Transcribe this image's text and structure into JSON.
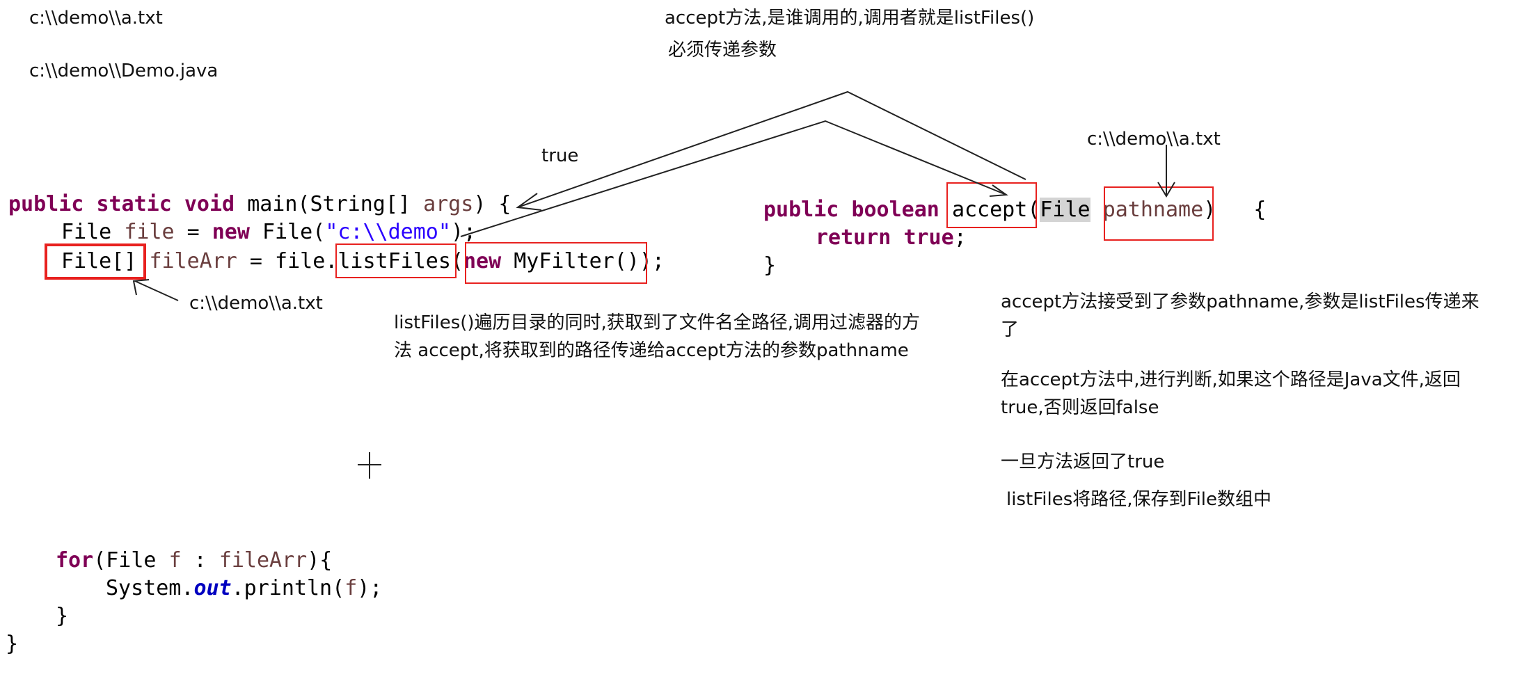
{
  "paths": {
    "a_txt": "c:\\\\demo\\\\a.txt",
    "demo_java": "c:\\\\demo\\\\Demo.java",
    "a_txt_below_file": "c:\\\\demo\\\\a.txt",
    "a_txt_pathname": "c:\\\\demo\\\\a.txt"
  },
  "notes": {
    "true_label": "true",
    "accept_caller_line1": "accept方法,是谁调用的,调用者就是listFiles()",
    "accept_caller_line2": "必须传递参数",
    "listfiles_explain": "listFiles()遍历目录的同时,获取到了文件名全路径,调用过滤器的方法 accept,将获取到的路径传递给accept方法的参数pathname",
    "accept_receive": "accept方法接受到了参数pathname,参数是listFiles传递来了",
    "accept_judge": "在accept方法中,进行判断,如果这个路径是Java文件,返回true,否则返回false",
    "once_true": "一旦方法返回了true",
    "save_array": "listFiles将路径,保存到File数组中"
  },
  "code_main": {
    "kw_public": "public",
    "kw_static": "static",
    "kw_void": "void",
    "main_sig": "main(String[] ",
    "args": "args",
    "open_brace": ") {",
    "file_type": "File ",
    "file_var": "file",
    "assign": " = ",
    "kw_new": "new",
    "new_file_call": " File(",
    "demo_string": "\"c:\\\\demo\"",
    "close_call": ");",
    "array_type": "File[]",
    "file_arr_var": "fileArr",
    "file_dot": " = file.",
    "list_files": "listFiles",
    "open_paren": "(",
    "my_filter": " MyFilter()",
    "end_call": ");",
    "kw_for": "for",
    "for_open": "(File ",
    "f_var": "f",
    "colon": " : ",
    "for_arr": "fileArr",
    "for_close": "){",
    "system": "System.",
    "out": "out",
    "println": ".println(",
    "f_arg": "f",
    "println_close": ");",
    "inner_close": "}",
    "outer_close": "}"
  },
  "code_accept": {
    "kw_public": "public",
    "kw_boolean": "boolean",
    "method": "accept",
    "open_paren": "(",
    "param_type": "File",
    "param_name": "pathname",
    "close_brace": ")   {",
    "kw_return": "return",
    "kw_true": "true",
    "semicolon": ";",
    "method_close": "}"
  },
  "colors": {
    "keyword": "#7f0055",
    "string": "#2a00ff",
    "variable": "#6a3e3e",
    "field": "#0000c0",
    "highlight_box": "#e8211f",
    "arrow": "#222222"
  }
}
